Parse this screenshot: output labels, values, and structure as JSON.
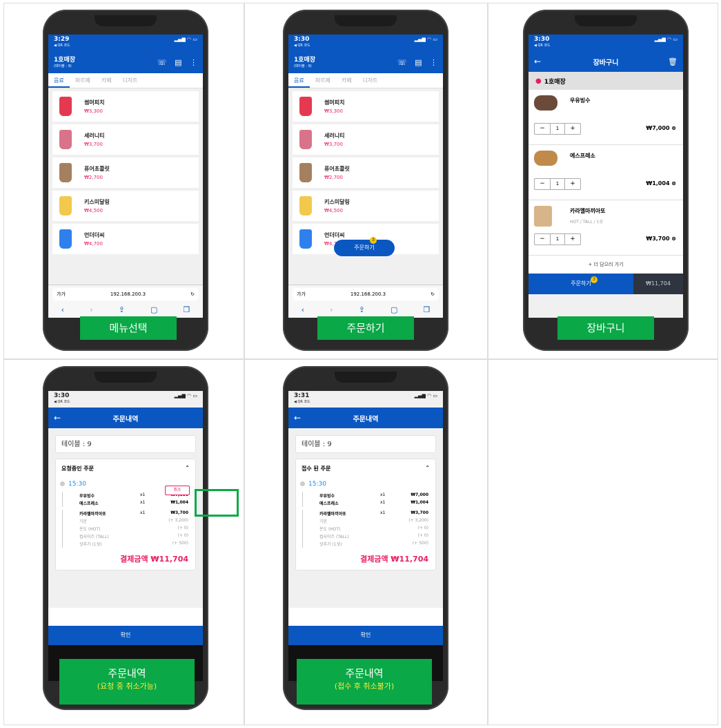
{
  "status": {
    "t1": "3:29",
    "t2": "3:30",
    "t3": "3:30",
    "t4": "3:30",
    "t5": "3:31",
    "sub": "◀ QR 코드",
    "icons": "▂▄▆ ◠ ▭"
  },
  "store": {
    "name": "1호매장",
    "table": "(테이블 : 9)",
    "loc": "1호매장"
  },
  "tabs": [
    "음료",
    "파르페",
    "카페",
    "디저트"
  ],
  "menu": [
    {
      "name": "썸머피치",
      "price": "₩3,300",
      "color": "#e53950"
    },
    {
      "name": "세러니티",
      "price": "₩3,700",
      "color": "#d9738a"
    },
    {
      "name": "퓨어초콜릿",
      "price": "₩2,700",
      "color": "#a5805e"
    },
    {
      "name": "키스미달링",
      "price": "₩4,500",
      "color": "#f2c94c"
    },
    {
      "name": "언더더씨",
      "price": "₩4,700",
      "color": "#2f80ed"
    }
  ],
  "browser": {
    "left": "가가",
    "url": "192.168.200.3",
    "reload": "↻"
  },
  "fab": {
    "label": "주문하기",
    "count": "3"
  },
  "cart": {
    "title": "장바구니",
    "items": [
      {
        "name": "우유빙수",
        "opt": "",
        "qty": "1",
        "price": "₩7,000 ⊗"
      },
      {
        "name": "에스프레소",
        "opt": "",
        "qty": "1",
        "price": "₩1,004 ⊗"
      },
      {
        "name": "카라멜마끼아또",
        "opt": "HOT / TALL / 1샷",
        "qty": "1",
        "price": "₩3,700 ⊗"
      }
    ],
    "more": "+ 더 담으러 가기",
    "order": "주문하기",
    "total": "₩11,704"
  },
  "history": {
    "title": "주문내역",
    "table": "테이블 : 9",
    "head_req": "요청중인 주문",
    "head_acc": "접수 된 주문",
    "time": "15:30",
    "cancel": "취소",
    "lines": [
      {
        "n": "우유빙수",
        "q": "x1",
        "p": "₩7,000"
      },
      {
        "n": "에스프레소",
        "q": "x1",
        "p": "₩1,004"
      },
      {
        "n": "카라멜마끼아또",
        "q": "x1",
        "p": "₩3,700"
      }
    ],
    "subs": [
      {
        "n": "기본",
        "p": "(+ 3,200)"
      },
      {
        "n": "온도 (HOT)",
        "p": "(+ 0)"
      },
      {
        "n": "컵사이즈 (TALL)",
        "p": "(+ 0)"
      },
      {
        "n": "샷추가 (1샷)",
        "p": "(+ 500)"
      }
    ],
    "total": "결제금액 ₩11,704",
    "confirm": "확인"
  },
  "labels": {
    "l1": "메뉴선택",
    "l2": "주문하기",
    "l3": "장바구니",
    "l4": "주문내역",
    "l4s": "(요청 중 취소가능)",
    "l5": "주문내역",
    "l5s": "(접수 후 취소불가)"
  }
}
